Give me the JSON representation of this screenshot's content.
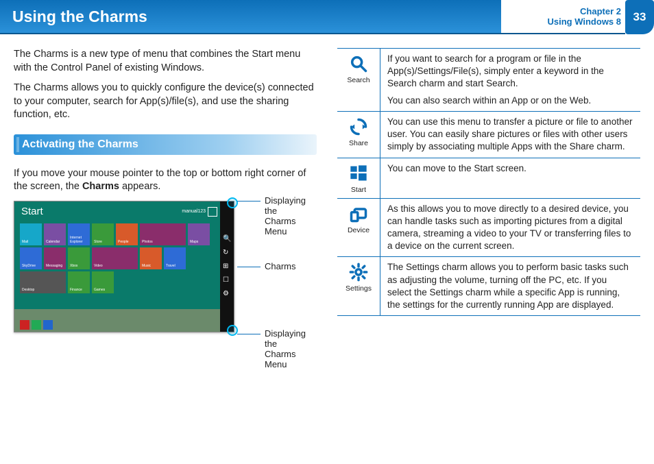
{
  "header": {
    "title": "Using the Charms",
    "chapter_line1": "Chapter 2",
    "chapter_line2": "Using Windows 8",
    "page_number": "33"
  },
  "intro": {
    "p1": "The Charms is a new type of menu that combines the Start menu with the Control Panel of existing Windows.",
    "p2": "The Charms allows you to quickly configure the device(s) connected to your computer, search for App(s)/file(s), and use the sharing function, etc."
  },
  "section": {
    "heading": "Activating the Charms",
    "p1a": "If you move your mouse pointer to the top or bottom right corner of the screen, the ",
    "p1b": "Charms",
    "p1c": " appears."
  },
  "screenshot": {
    "start_label": "Start",
    "user_name": "manual123",
    "callout_top": "Displaying the Charms Menu",
    "callout_mid": "Charms",
    "callout_bot": "Displaying the Charms Menu",
    "tiles": [
      {
        "label": "Mail",
        "color": "#16a7c9",
        "w": "tw"
      },
      {
        "label": "Calendar",
        "color": "#7a4ea3",
        "w": "tw"
      },
      {
        "label": "Internet Explorer",
        "color": "#2e6bd6",
        "w": "tw"
      },
      {
        "label": "Store",
        "color": "#3a9a3a",
        "w": "tw"
      },
      {
        "label": "People",
        "color": "#d85a2a",
        "w": "tw"
      },
      {
        "label": "Photos",
        "color": "#8a2d6b",
        "w": "tw2"
      },
      {
        "label": "Maps",
        "color": "#7a4ea3",
        "w": "tw"
      },
      {
        "label": "SkyDrive",
        "color": "#2e6bd6",
        "w": "tw"
      },
      {
        "label": "Messaging",
        "color": "#8a2d6b",
        "w": "tw"
      },
      {
        "label": "Xbox",
        "color": "#3a9a3a",
        "w": "tw"
      },
      {
        "label": "Video",
        "color": "#8a2d6b",
        "w": "tw2"
      },
      {
        "label": "Music",
        "color": "#d85a2a",
        "w": "tw"
      },
      {
        "label": "Travel",
        "color": "#2e6bd6",
        "w": "tw"
      },
      {
        "label": "Desktop",
        "color": "#555",
        "w": "tw2"
      },
      {
        "label": "Finance",
        "color": "#3a9a3a",
        "w": "tw"
      },
      {
        "label": "Games",
        "color": "#3a9a3a",
        "w": "tw"
      }
    ]
  },
  "charms": [
    {
      "name": "Search",
      "desc": [
        "If you want to search for a program or file in the App(s)/Settings/File(s), simply enter a keyword in the Search charm and start Search.",
        "You can also search within an App or on the Web."
      ]
    },
    {
      "name": "Share",
      "desc": [
        "You can use this menu to transfer a picture or file to another user. You can easily share pictures or files with other users simply by associating multiple Apps with the Share charm."
      ]
    },
    {
      "name": "Start",
      "desc": [
        "You can move to the Start screen."
      ]
    },
    {
      "name": "Device",
      "desc": [
        "As this allows you to move directly to a desired device, you can handle tasks such as importing pictures from a digital camera, streaming a video to your TV or transferring files to a device on the current screen."
      ]
    },
    {
      "name": "Settings",
      "desc": [
        "The Settings charm allows you to perform basic tasks such as adjusting the volume, turning off the PC, etc. If you select the Settings charm while a specific App is running, the settings for the currently running App are displayed."
      ]
    }
  ]
}
